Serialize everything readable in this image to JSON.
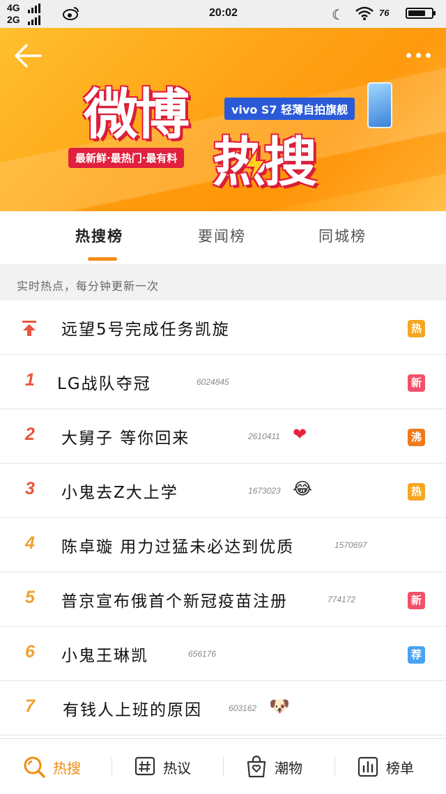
{
  "status_bar": {
    "network_1": "4G",
    "network_2": "2G",
    "time": "20:02",
    "battery_percent": "76",
    "battery_level": 0.76
  },
  "banner": {
    "title_part1": "微博",
    "title_part2": "热搜",
    "sponsor": "vivo S7 轻薄自拍旗舰",
    "slogan": "最新鲜·最热门·最有料"
  },
  "tabs": [
    {
      "label": "热搜榜",
      "active": true
    },
    {
      "label": "要闻榜",
      "active": false
    },
    {
      "label": "同城榜",
      "active": false
    }
  ],
  "subheader": "实时热点，每分钟更新一次",
  "hot_list": [
    {
      "rank": "",
      "pinned": true,
      "topic": "远望5号完成任务凯旋",
      "count": "",
      "emoji": "",
      "badge": "热",
      "badge_color": "#f5a623"
    },
    {
      "rank": "1",
      "topic": "LG战队夺冠",
      "count": "6024845",
      "emoji": "",
      "badge": "新",
      "badge_color": "#f2516a"
    },
    {
      "rank": "2",
      "topic": "大舅子 等你回来",
      "count": "2610411",
      "emoji": "❤",
      "badge": "沸",
      "badge_color": "#f07a1a"
    },
    {
      "rank": "3",
      "topic": "小鬼去Z大上学",
      "count": "1673023",
      "emoji": "😂",
      "badge": "热",
      "badge_color": "#f5a623"
    },
    {
      "rank": "4",
      "topic": "陈卓璇 用力过猛未必达到优质",
      "count": "1570697",
      "emoji": "",
      "badge": "",
      "badge_color": ""
    },
    {
      "rank": "5",
      "topic": "普京宣布俄首个新冠疫苗注册",
      "count": "774172",
      "emoji": "",
      "badge": "新",
      "badge_color": "#f2516a"
    },
    {
      "rank": "6",
      "topic": "小鬼王琳凯",
      "count": "656176",
      "emoji": "",
      "badge": "荐",
      "badge_color": "#4aa3f0"
    },
    {
      "rank": "7",
      "topic": "有钱人上班的原因",
      "count": "603162",
      "emoji": "🐶",
      "badge": "",
      "badge_color": ""
    }
  ],
  "colors": {
    "accent": "#f28c12",
    "rank_top3": "#e8553e",
    "rank_other": "#f0a030"
  },
  "bottom_nav": [
    {
      "label": "热搜",
      "icon": "search-icon",
      "active": true
    },
    {
      "label": "热议",
      "icon": "hashtag-icon",
      "active": false
    },
    {
      "label": "潮物",
      "icon": "shopping-bag-icon",
      "active": false
    },
    {
      "label": "榜单",
      "icon": "bar-chart-icon",
      "active": false
    }
  ]
}
